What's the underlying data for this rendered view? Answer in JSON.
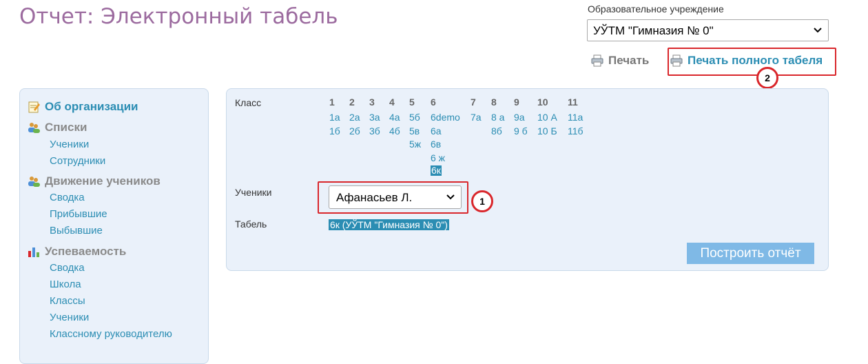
{
  "page": {
    "title": "Отчет: Электронный табель"
  },
  "org": {
    "label": "Образовательное учреждение",
    "selected": "УЎТМ \"Гимназия № 0\""
  },
  "actions": {
    "print": "Печать",
    "print_full": "Печать полного табеля"
  },
  "markers": {
    "m1": "1",
    "m2": "2"
  },
  "sidebar": {
    "org_info": "Об организации",
    "lists": {
      "title": "Списки",
      "items": [
        "Ученики",
        "Сотрудники"
      ]
    },
    "movement": {
      "title": "Движение учеников",
      "items": [
        "Сводка",
        "Прибывшие",
        "Выбывшие"
      ]
    },
    "performance": {
      "title": "Успеваемость",
      "items": [
        "Сводка",
        "Школа",
        "Классы",
        "Ученики",
        "Классному руководителю"
      ]
    }
  },
  "form": {
    "class_label": "Класс",
    "grades": [
      {
        "num": "1",
        "classes": [
          "1а",
          "1б"
        ]
      },
      {
        "num": "2",
        "classes": [
          "2а",
          "2б"
        ]
      },
      {
        "num": "3",
        "classes": [
          "3а",
          "3б"
        ]
      },
      {
        "num": "4",
        "classes": [
          "4а",
          "4б"
        ]
      },
      {
        "num": "5",
        "classes": [
          "5б",
          "5в",
          "5ж"
        ]
      },
      {
        "num": "6",
        "classes": [
          "6demo",
          "6а",
          "6в",
          "6 ж",
          "6к"
        ]
      },
      {
        "num": "",
        "classes": [
          "7а"
        ]
      },
      {
        "num": "8",
        "classes": [
          "8 а",
          "8б"
        ]
      },
      {
        "num": "9",
        "classes": [
          "9а",
          "9 б"
        ]
      },
      {
        "num": "10",
        "classes": [
          "10 А",
          "10 Б"
        ]
      },
      {
        "num": "11",
        "classes": [
          "11а",
          "11б"
        ]
      }
    ],
    "grade7_num": "7",
    "selected_class": "6к",
    "students_label": "Ученики",
    "student_selected": "Афанасьев Л.",
    "tabel_label": "Табель",
    "tabel_value": "6к (УЎТМ \"Гимназия № 0\")",
    "build_button": "Построить отчёт"
  },
  "colors": {
    "title": "#9c6b9f",
    "link": "#2b8db3",
    "panel": "#eaf1fa",
    "highlight": "#d9262b",
    "button": "#7fb9e6"
  }
}
